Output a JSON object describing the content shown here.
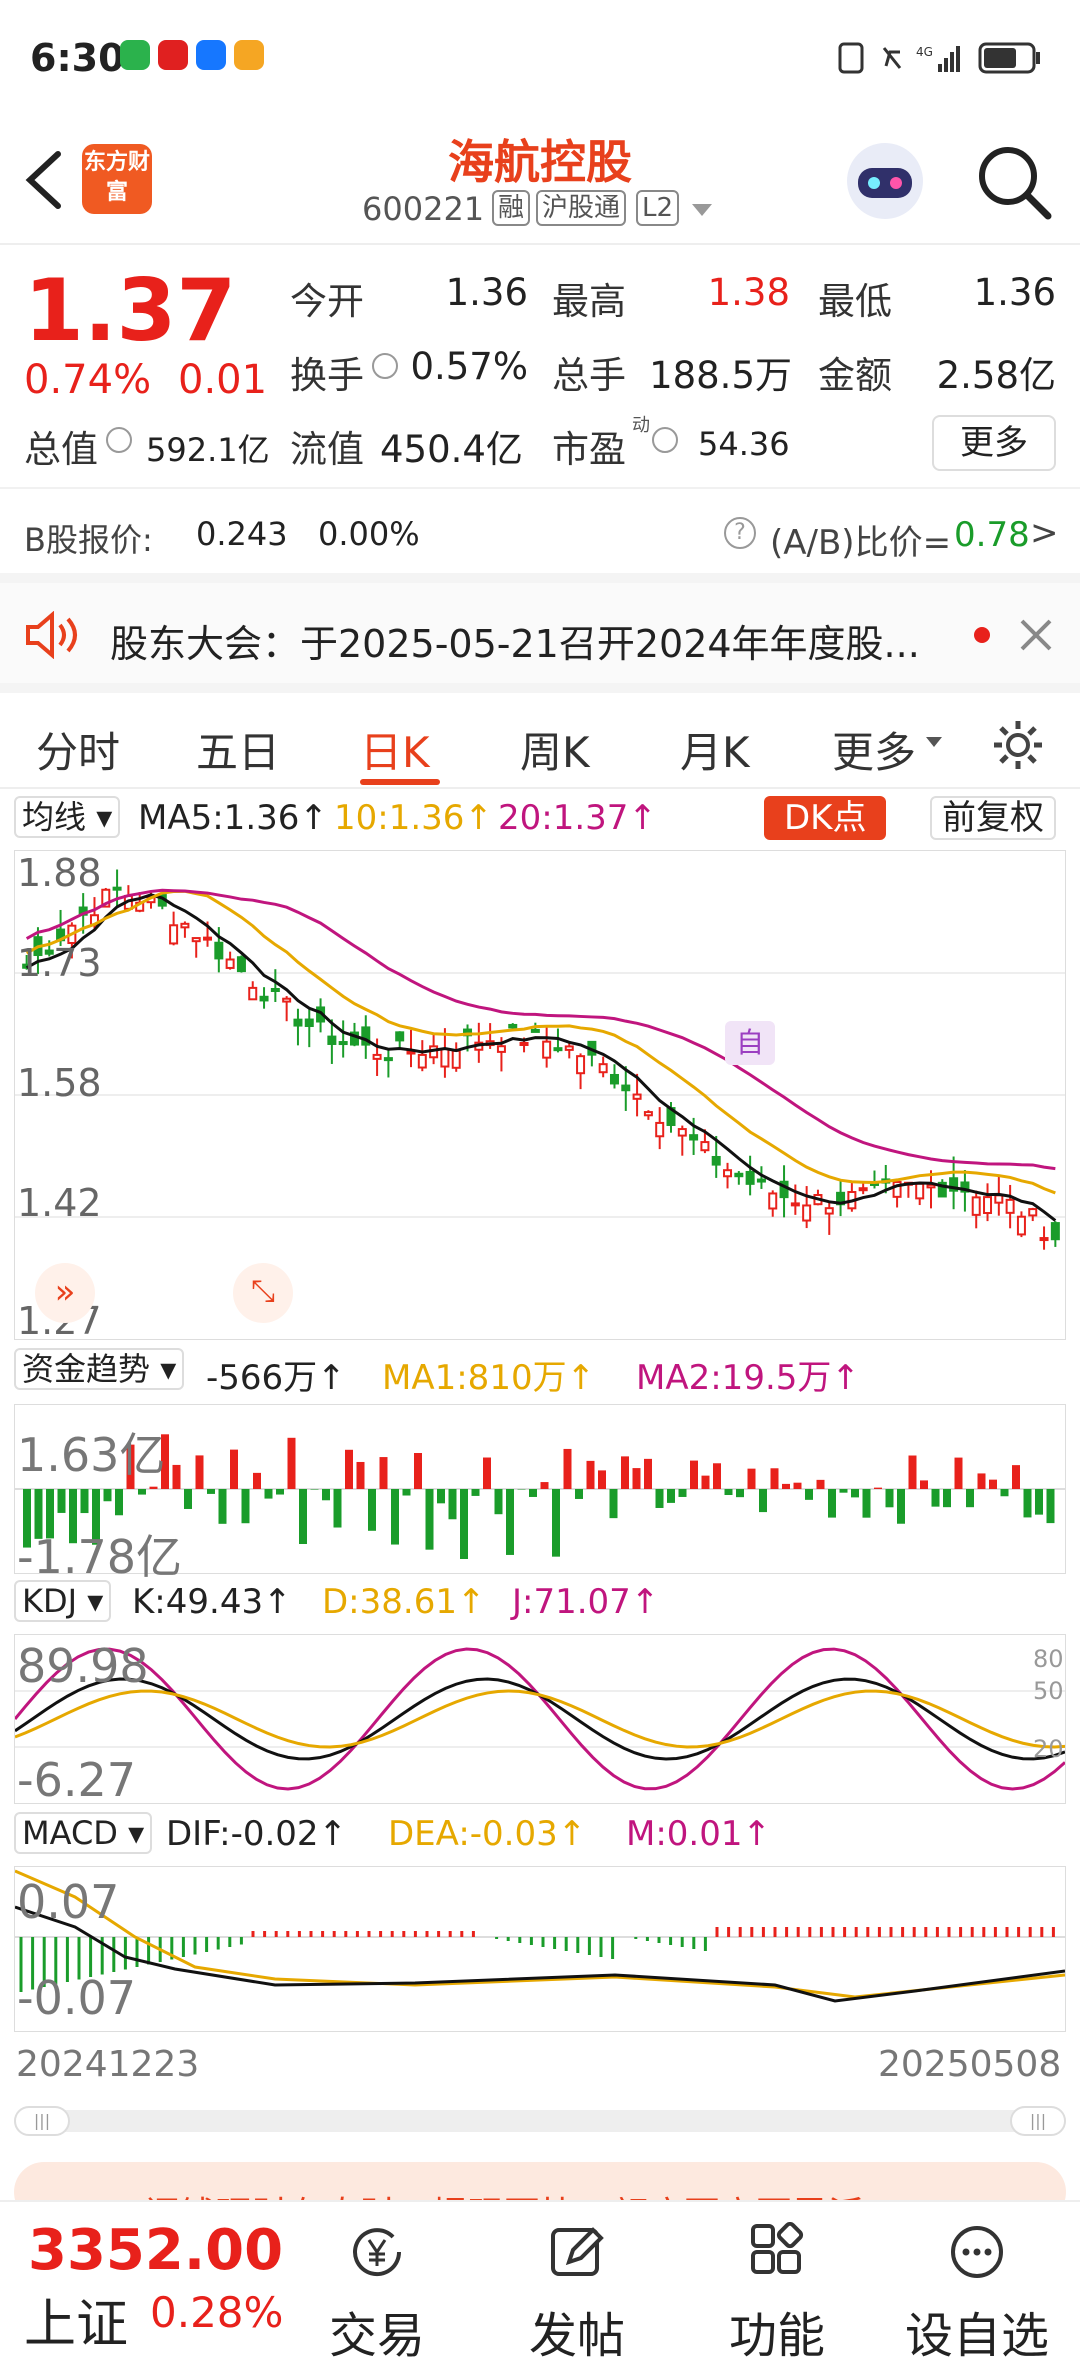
{
  "status": {
    "time": "6:30",
    "network": "4G"
  },
  "header": {
    "logo_text": "东方财富",
    "stock_name": "海航控股",
    "stock_code": "600221",
    "tags": [
      "融",
      "沪股通",
      "L2"
    ]
  },
  "quote": {
    "price": "1.37",
    "change_pct": "0.74%",
    "change_amt": "0.01",
    "open_label": "今开",
    "open": "1.36",
    "high_label": "最高",
    "high": "1.38",
    "low_label": "最低",
    "low": "1.36",
    "turnover_label": "换手",
    "turnover": "0.57%",
    "volume_label": "总手",
    "volume": "188.5万",
    "amount_label": "金额",
    "amount": "2.58亿",
    "mktcap_label": "总值",
    "mktcap": "592.1亿",
    "float_label": "流值",
    "float": "450.4亿",
    "pe_label": "市盈",
    "pe_sup": "动",
    "pe": "54.36",
    "more_label": "更多"
  },
  "bshare": {
    "label": "B股报价:",
    "price": "0.243",
    "pct": "0.00%",
    "ratio_label": "(A/B)比价=",
    "ratio": "0.78",
    "arrow": ">"
  },
  "notice": {
    "text": "股东大会：于2025-05-21召开2024年年度股..."
  },
  "tabs": [
    "分时",
    "五日",
    "日K",
    "周K",
    "月K",
    "更多"
  ],
  "active_tab": "日K",
  "kline": {
    "selector": "均线",
    "ma5": "MA5:1.36↑",
    "ma10": "10:1.36↑",
    "ma20": "20:1.37↑",
    "dk_label": "DK点",
    "adjust_label": "前复权",
    "y_labels": [
      "1.88",
      "1.73",
      "1.58",
      "1.42",
      "1.27"
    ],
    "marker_auto": "自"
  },
  "fund": {
    "selector": "资金趋势",
    "value": "-566万↑",
    "ma1": "MA1:810万↑",
    "ma2": "MA2:19.5万↑",
    "y_top": "1.63亿",
    "y_bottom": "-1.78亿"
  },
  "kdj": {
    "selector": "KDJ",
    "k": "K:49.43↑",
    "d": "D:38.61↑",
    "j": "J:71.07↑",
    "y_top": "89.98",
    "y_bottom": "-6.27",
    "ref_levels": [
      "80",
      "50",
      "20"
    ]
  },
  "macd": {
    "selector": "MACD",
    "dif": "DIF:-0.02↑",
    "dea": "DEA:-0.03↑",
    "m": "M:0.01↑",
    "y_top": "0.07",
    "y_bottom": "-0.07"
  },
  "dates": {
    "start": "20241223",
    "end": "20250508"
  },
  "banner": {
    "text": "闲钱理财有奇财！提现更快，额度更高更灵活"
  },
  "index": {
    "value": "3352.00",
    "name": "上证",
    "pct": "0.28%"
  },
  "nav": [
    "交易",
    "发帖",
    "功能",
    "设自选"
  ],
  "colors": {
    "up": "#e8211b",
    "down": "#1a9c2a",
    "brand": "#e8401c",
    "ma10": "#e6a800",
    "ma20": "#c0157e"
  }
}
